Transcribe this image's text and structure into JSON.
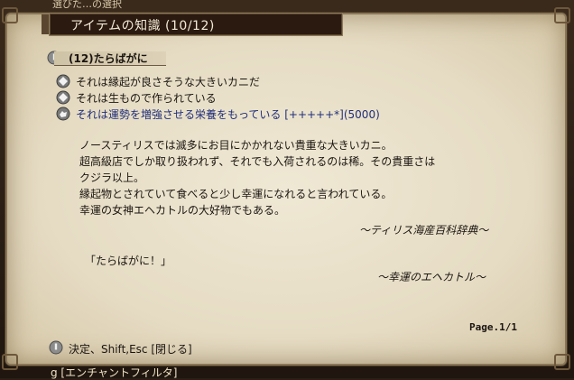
{
  "window": {
    "background_title": "選びた…の選択",
    "title": "アイテムの知識 (10/12)"
  },
  "item": {
    "header": "(12)たらばがに",
    "traits": [
      {
        "icon": "diamond-bullet-icon",
        "text": "それは縁起が良さそうな大きいカニだ"
      },
      {
        "icon": "diamond-bullet-icon",
        "text": "それは生もので作られている"
      },
      {
        "icon": "hand-bullet-icon",
        "text": "それは運勢を増強させる栄養をもっている [+++++*](5000)"
      }
    ],
    "description": [
      "ノースティリスでは滅多にお目にかかれない貴重な大きいカニ。",
      "超高級店でしか取り扱われず、それでも入荷されるのは稀。その貴重さは",
      "クジラ以上。",
      "縁起物とされていて食べると少し幸運になれると言われている。",
      "幸運の女神エヘカトルの大好物でもある。"
    ],
    "attribution_1": "～ティリス海産百科辞典～",
    "quote": "「たらばがに！」",
    "attribution_2": "～幸運のエヘカトル～"
  },
  "pagination": {
    "label": "Page.1/1"
  },
  "footer": {
    "hint": "決定、Shift,Esc [閉じる]"
  },
  "behind": {
    "label": "g [エンチャントフィルタ]"
  },
  "colors": {
    "parchment": "#e8e0c8",
    "title_bg": "#2a1a10",
    "text": "#1b1511",
    "link_blue": "#202e7a"
  }
}
